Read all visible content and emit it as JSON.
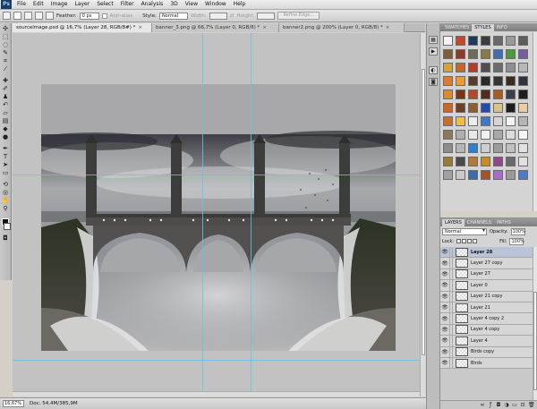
{
  "menu": {
    "app_badge": "Ps",
    "items": [
      "File",
      "Edit",
      "Image",
      "Layer",
      "Select",
      "Filter",
      "Analysis",
      "3D",
      "View",
      "Window",
      "Help"
    ]
  },
  "options": {
    "feather_label": "Feather:",
    "feather_value": "0 px",
    "antialias_label": "Anti-alias",
    "style_label": "Style:",
    "style_value": "Normal",
    "width_label": "Width:",
    "height_label": "Height:",
    "refine_label": "Refine Edge..."
  },
  "tabs": [
    {
      "label": "sourceimage.psd @ 16,7% (Layer 28, RGB/8#) *",
      "close": "×"
    },
    {
      "label": "banner_3.png @ 66,7% (Layer 0, RGB/8) *",
      "close": "×"
    },
    {
      "label": "banner2.png @ 200% (Layer 0, RGB/8) *",
      "close": "×"
    }
  ],
  "status": {
    "zoom": "16,67%",
    "doc": "Doc: 54,4M/385,9M"
  },
  "styles_panel": {
    "tabs": [
      "SWATCHES",
      "STYLES",
      "INFO"
    ],
    "active_tab": "STYLES",
    "cells": [
      "#f4f4f4",
      "#c4472b",
      "#1f3a5f",
      "#3b3b3b",
      "#6a6a6a",
      "#9a9a9a",
      "#5c5c5c",
      "#7c5f3a",
      "#8c3b2a",
      "#6e6b5a",
      "#8a7a4a",
      "#3f6fb0",
      "#4b9a3c",
      "#7a5aa0",
      "#d7a338",
      "#c8662a",
      "#b53c2a",
      "#4f4f4f",
      "#6c6c6c",
      "#8f8f8f",
      "#b9b9b9",
      "#e07b2d",
      "#ee9a35",
      "#5a3a2a",
      "#2a2a2a",
      "#343434",
      "#3c2a1a",
      "#2e3440",
      "#d98a2c",
      "#7b3418",
      "#b34a23",
      "#4e2e1e",
      "#a85b23",
      "#3a3f4a",
      "#1e1e1e",
      "#c56a2a",
      "#6b4026",
      "#8c5c34",
      "#1f4fa8",
      "#d8c38a",
      "#1d1d1d",
      "#e6d0a3",
      "#d06c26",
      "#f0c030",
      "#ececec",
      "#3e78c8",
      "#d4d4d4",
      "#f4f4f4",
      "#b4b4b4",
      "#8a7a5a",
      "#b0b0b0",
      "#e8e8e8",
      "#f2f2f2",
      "#a8a8a8",
      "#dddddd",
      "#f6f6f6",
      "#8c8c8c",
      "#b6b6b6",
      "#2e7fd0",
      "#cfcfcf",
      "#9c9c9c",
      "#c0c0c0",
      "#e2e2e2",
      "#9a7a3a",
      "#4a4a4a",
      "#b07a3a",
      "#c48c2a",
      "#8c4a8c",
      "#6a6a6a",
      "#e0e0e0",
      "#a0a0a0",
      "#c9c9c9",
      "#3a6ab0",
      "#a85028",
      "#a86bd0",
      "#9a9a9a",
      "#4a7ac8"
    ]
  },
  "layers_panel": {
    "tabs": [
      "LAYERS",
      "CHANNELS",
      "PATHS"
    ],
    "active_tab": "LAYERS",
    "blend_mode": "Normal",
    "opacity_label": "Opacity:",
    "opacity_value": "100%",
    "lock_label": "Lock:",
    "fill_label": "Fill:",
    "fill_value": "100%",
    "layers": [
      {
        "name": "Layer 28",
        "active": true
      },
      {
        "name": "Layer 27 copy",
        "active": false
      },
      {
        "name": "Layer 27",
        "active": false
      },
      {
        "name": "Layer 0",
        "active": false
      },
      {
        "name": "Layer 21 copy",
        "active": false
      },
      {
        "name": "Layer 21",
        "active": false
      },
      {
        "name": "Layer 4 copy 2",
        "active": false
      },
      {
        "name": "Layer 4 copy",
        "active": false
      },
      {
        "name": "Layer 4",
        "active": false
      },
      {
        "name": "Birds copy",
        "active": false
      },
      {
        "name": "Birds",
        "active": false
      }
    ]
  }
}
